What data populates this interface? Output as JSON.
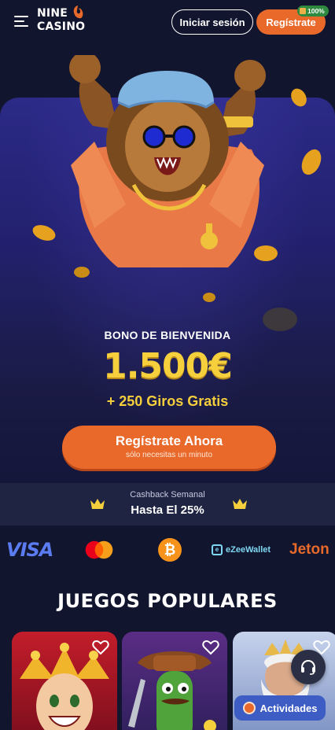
{
  "header": {
    "logo_line1": "NINE",
    "logo_line2": "CASINO",
    "login_label": "Iniciar sesión",
    "register_label": "Regístrate",
    "register_badge": "100%"
  },
  "hero": {
    "bonus_label": "BONO DE BIENVENIDA",
    "bonus_amount": "1.500€",
    "bonus_extra": "+ 250 Giros Gratis",
    "cta_label": "Regístrate Ahora",
    "cta_sub": "sólo necesitas un minuto"
  },
  "cashback": {
    "label": "Cashback Semanal",
    "value": "Hasta El 25%"
  },
  "payments": {
    "visa": "VISA",
    "bitcoin_symbol": "₿",
    "ezee": "eZeeWallet",
    "jeton": "Jeton"
  },
  "games": {
    "title": "JUEGOS POPULARES"
  },
  "floating": {
    "activities_label": "Actividades"
  },
  "colors": {
    "background": "#12152e",
    "accent": "#e8692a",
    "gold": "#f5cf3c",
    "activities": "#3d5cc4"
  },
  "icons": [
    "menu-icon",
    "crown-icon",
    "heart-icon",
    "headset-icon",
    "gift-icon",
    "mastercard-icon",
    "bitcoin-icon"
  ]
}
